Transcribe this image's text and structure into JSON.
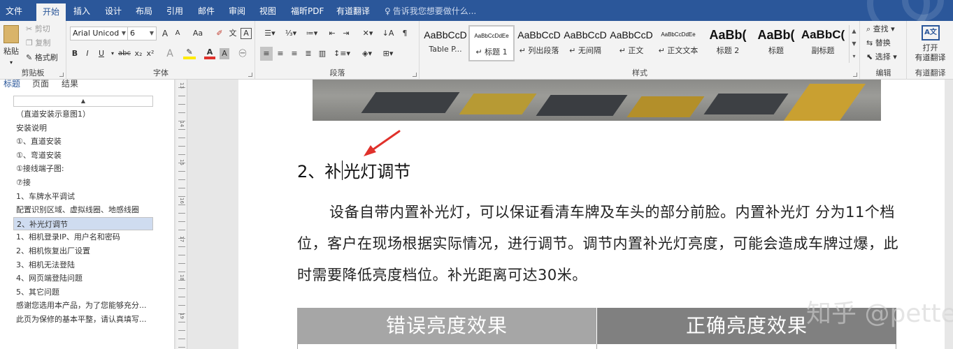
{
  "menu_tabs": [
    "文件",
    "开始",
    "插入",
    "设计",
    "布局",
    "引用",
    "邮件",
    "审阅",
    "视图",
    "福昕PDF",
    "有道翻译"
  ],
  "tell_me": "告诉我您想要做什么...",
  "clipboard": {
    "paste": "粘贴",
    "cut": "剪切",
    "copy": "复制",
    "format_painter": "格式刷",
    "label": "剪贴板"
  },
  "font": {
    "name": "Arial Unicod",
    "size": "6",
    "label": "字体",
    "grow": "A",
    "shrink": "A",
    "case": "Aa",
    "bold": "B",
    "italic": "I",
    "underline": "U",
    "strike": "abc",
    "sub": "x₂",
    "sup": "x²",
    "effects": "A",
    "color": "A",
    "char_shade": "A"
  },
  "paragraph": {
    "label": "段落"
  },
  "styles": {
    "label": "样式",
    "items": [
      {
        "preview": "AaBbCcD",
        "name": "Table P..."
      },
      {
        "preview": "AaBbCcDdEe",
        "name": "↵ 标题 1"
      },
      {
        "preview": "AaBbCcD",
        "name": "↵ 列出段落"
      },
      {
        "preview": "AaBbCcD",
        "name": "↵ 无间隔"
      },
      {
        "preview": "AaBbCcD",
        "name": "↵ 正文"
      },
      {
        "preview": "AaBbCcDdEe",
        "name": "↵ 正文文本"
      },
      {
        "preview": "AaBb(",
        "name": "标题 2"
      },
      {
        "preview": "AaBb(",
        "name": "标题"
      },
      {
        "preview": "AaBbC(",
        "name": "副标题"
      }
    ]
  },
  "editing": {
    "find": "查找",
    "replace": "替换",
    "select": "选择",
    "label": "编辑"
  },
  "youdao": {
    "line1": "打开",
    "line2": "有道翻译",
    "label": "有道翻译"
  },
  "nav": {
    "tabs": [
      "标题",
      "页面",
      "结果"
    ],
    "items": [
      "（直道安装示意图1）",
      "安装说明",
      "①、直道安装",
      "①、弯道安装",
      "①接线端子图:",
      "⑦接",
      "1、车牌水平调试",
      "配置识别区域、虚拟线圈、地感线圈",
      "2、补光灯调节",
      "1、相机登录IP、用户名和密码",
      "2、相机恢复出厂设置",
      "3、相机无法登陆",
      "4、网页端登陆问题",
      "5、其它问题",
      "感谢您选用本产品，为了您能够充分...",
      "此页为保修的基本平整，请认真填写..."
    ],
    "selected_index": 8
  },
  "ruler_numbers": [
    "13",
    "14",
    "15",
    "16",
    "17",
    "18",
    "19"
  ],
  "document": {
    "heading_before": "2、补",
    "heading_after": "光灯调节",
    "body": "设备自带内置补光灯，可以保证看清车牌及车头的部分前脸。内置补光灯  分为11个档位，客户在现场根据实际情况，进行调节。调节内置补光灯亮度，可能会造成车牌过爆，此时需要降低亮度档位。补光距离可达30米。",
    "table_headers": [
      "错误亮度效果",
      "正确亮度效果"
    ]
  },
  "watermark": "知乎 @petter",
  "colors": {
    "brand": "#2b579a",
    "nav_selected": "#cfdcf0",
    "table_header_left": "#a6a6a6",
    "table_header_right": "#808080",
    "arrow": "#e0312b"
  }
}
